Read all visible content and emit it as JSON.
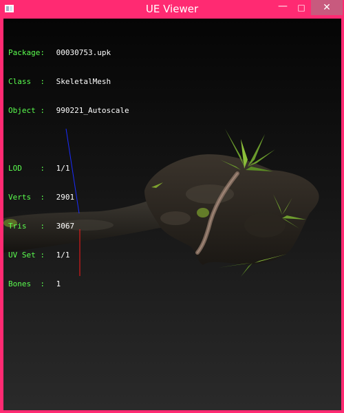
{
  "window": {
    "title": "UE Viewer",
    "controls": {
      "minimize": "—",
      "maximize": "□",
      "close": "✕"
    },
    "frame_color": "#ff2a72"
  },
  "info": {
    "package": {
      "label": "Package:",
      "value": "00030753.upk"
    },
    "class": {
      "label": "Class  :",
      "value": "SkeletalMesh"
    },
    "object": {
      "label": "Object :",
      "value": "990221_Autoscale"
    },
    "lod": {
      "label": "LOD    :",
      "value": "1/1"
    },
    "verts": {
      "label": "Verts  :",
      "value": "2901"
    },
    "tris": {
      "label": "Tris   :",
      "value": "3067"
    },
    "uvset": {
      "label": "UV Set :",
      "value": "1/1"
    },
    "bones": {
      "label": "Bones  :",
      "value": "1"
    }
  },
  "colors": {
    "label_text": "#5bff4f",
    "value_text": "#ffffff"
  }
}
